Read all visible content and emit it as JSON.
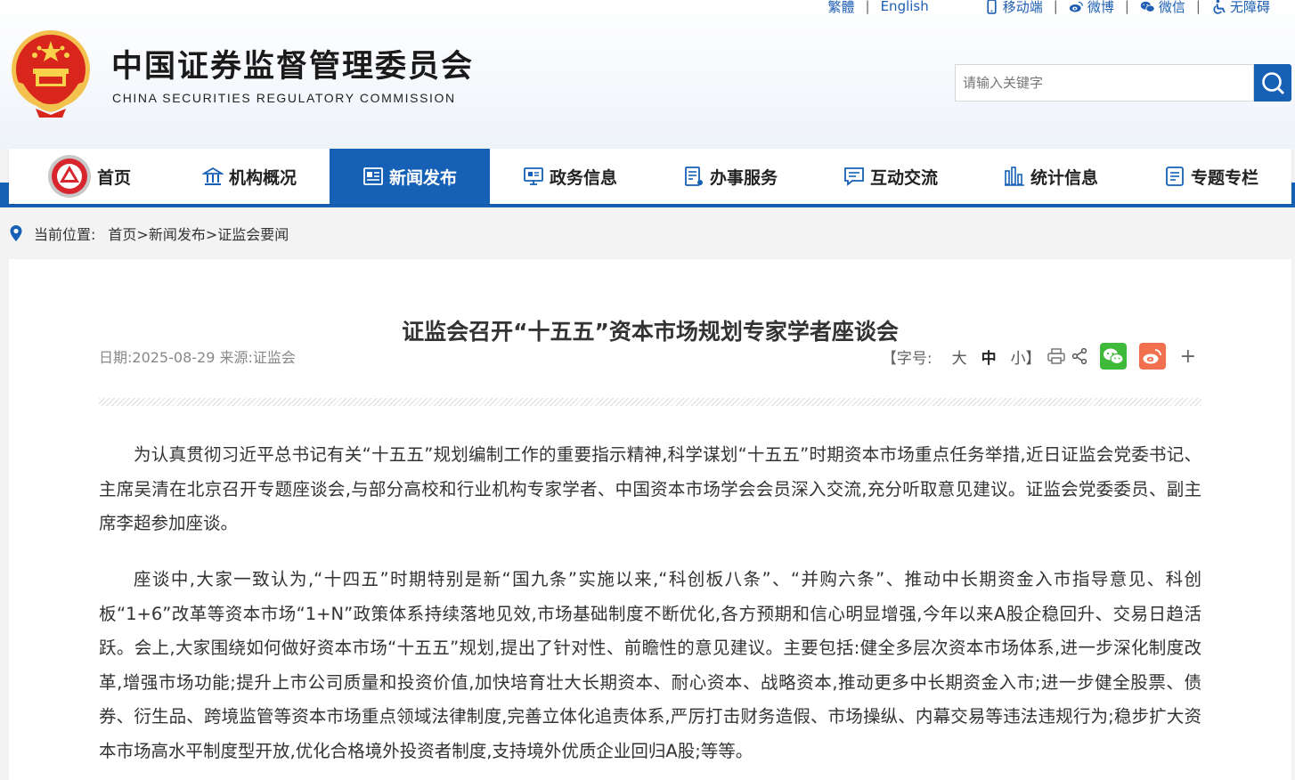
{
  "header": {
    "top_links": {
      "traditional": "繁體",
      "english": "English",
      "mobile": "移动端",
      "weibo": "微博",
      "wechat": "微信",
      "accessibility": "无障碍"
    },
    "title": "中国证券监督管理委员会",
    "subtitle": "CHINA SECURITIES REGULATORY COMMISSION",
    "search": {
      "placeholder": "请输入关键字"
    }
  },
  "nav": {
    "items": [
      {
        "label": "首页",
        "icon": "csrc-logo-icon"
      },
      {
        "label": "机构概况",
        "icon": "building-icon"
      },
      {
        "label": "新闻发布",
        "icon": "news-icon",
        "active": true
      },
      {
        "label": "政务信息",
        "icon": "monitor-icon"
      },
      {
        "label": "办事服务",
        "icon": "document-icon"
      },
      {
        "label": "互动交流",
        "icon": "chat-icon"
      },
      {
        "label": "统计信息",
        "icon": "bar-chart-icon"
      },
      {
        "label": "专题专栏",
        "icon": "list-doc-icon"
      }
    ],
    "active_color": "#1661b5"
  },
  "breadcrumb": {
    "label": "当前位置:",
    "path": "首页>新闻发布>证监会要闻"
  },
  "article": {
    "title": "证监会召开“十五五”资本市场规划专家学者座谈会",
    "meta": "日期:2025-08-29 来源:证监会",
    "tools": {
      "font_size_label": "【字号:",
      "large": "大",
      "medium": "中",
      "small": "小】",
      "plus": "+"
    },
    "paragraphs": [
      "为认真贯彻习近平总书记有关“十五五”规划编制工作的重要指示精神,科学谋划“十五五”时期资本市场重点任务举措,近日证监会党委书记、主席吴清在北京召开专题座谈会,与部分高校和行业机构专家学者、中国资本市场学会会员深入交流,充分听取意见建议。证监会党委委员、副主席李超参加座谈。",
      "座谈中,大家一致认为,“十四五”时期特别是新“国九条”实施以来,“科创板八条”、“并购六条”、推动中长期资金入市指导意见、科创板“1+6”改革等资本市场“1+N”政策体系持续落地见效,市场基础制度不断优化,各方预期和信心明显增强,今年以来A股企稳回升、交易日趋活跃。会上,大家围绕如何做好资本市场“十五五”规划,提出了针对性、前瞻性的意见建议。主要包括:健全多层次资本市场体系,进一步深化制度改革,增强市场功能;提升上市公司质量和投资价值,加快培育壮大长期资本、耐心资本、战略资本,推动更多中长期资金入市;进一步健全股票、债券、衍生品、跨境监管等资本市场重点领域法律制度,完善立体化追责体系,严厉打击财务造假、市场操纵、内幕交易等违法违规行为;稳步扩大资本市场高水平制度型开放,优化合格境外投资者制度,支持境外优质企业回归A股;等等。"
    ]
  },
  "colors": {
    "brand_blue": "#1661b5",
    "link_blue": "#1e5fb3",
    "wechat_green": "#3fb93a",
    "weibo_red": "#f0704f"
  }
}
